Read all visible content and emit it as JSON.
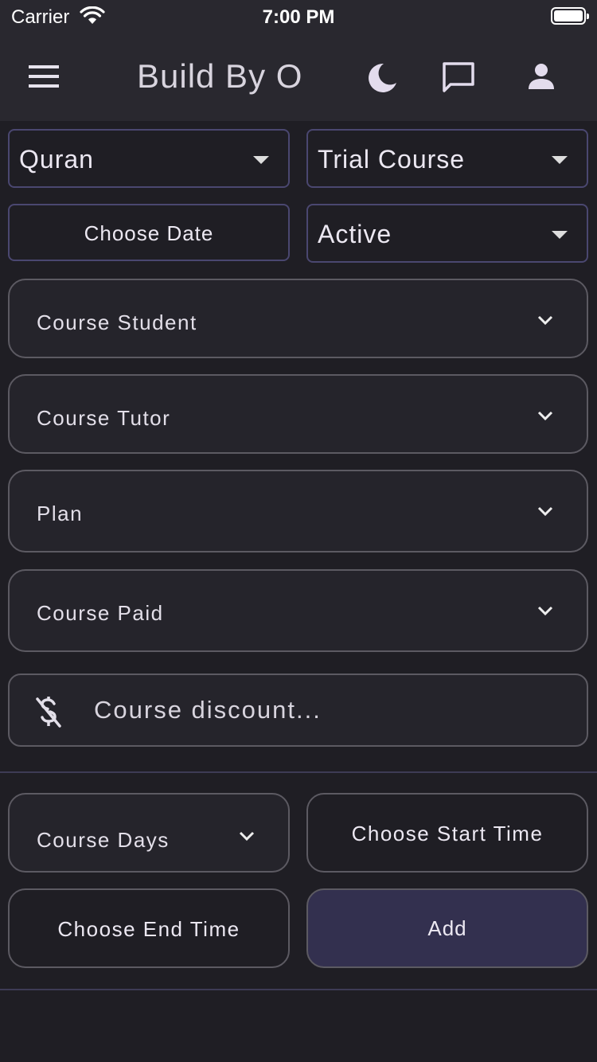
{
  "status_bar": {
    "carrier": "Carrier",
    "time": "7:00 PM"
  },
  "app_bar": {
    "title": "Build By O",
    "icons": [
      "menu-icon",
      "moon-icon",
      "chat-icon",
      "person-icon"
    ]
  },
  "filters": {
    "subject": {
      "value": "Quran"
    },
    "course_type": {
      "value": "Trial Course"
    },
    "choose_date_label": "Choose Date",
    "status": {
      "value": "Active"
    }
  },
  "form": {
    "course_student": "Course Student",
    "course_tutor": "Course Tutor",
    "plan": "Plan",
    "course_paid": "Course Paid",
    "discount_placeholder": "Course discount..."
  },
  "schedule": {
    "course_days": "Course Days",
    "start_time_label": "Choose Start Time",
    "end_time_label": "Choose End Time",
    "add_label": "Add"
  },
  "colors": {
    "background": "#1f1e24",
    "app_bar": "#29282f",
    "accent_border": "#4a4770",
    "add_button": "#33304f"
  }
}
